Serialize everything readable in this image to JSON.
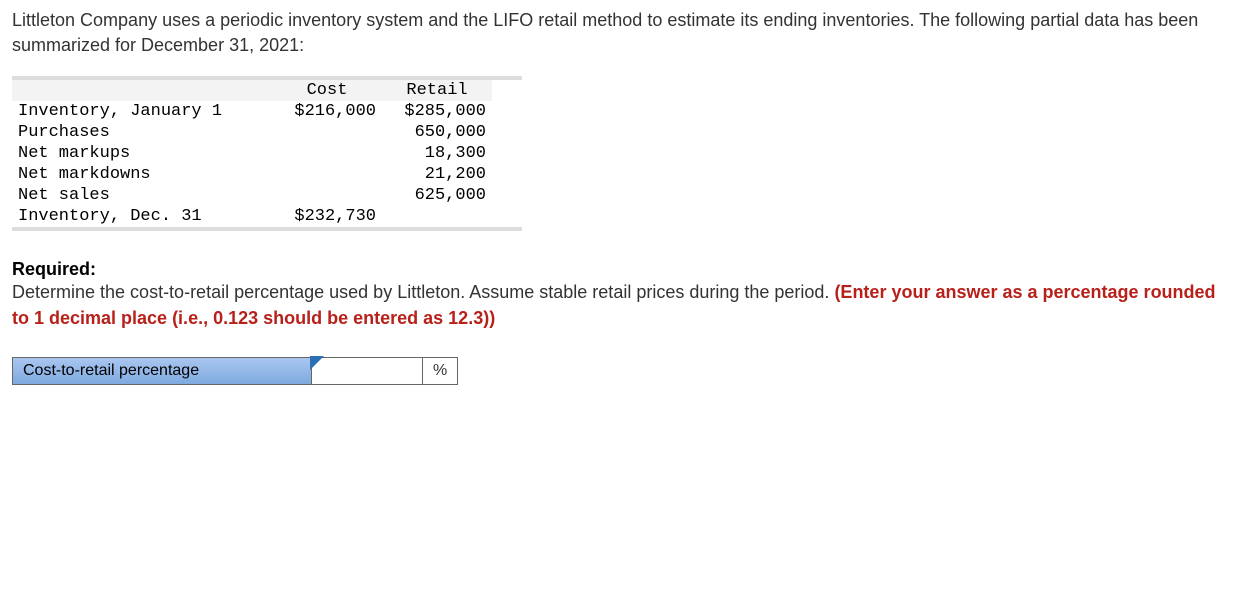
{
  "problem": {
    "text": "Littleton Company uses a periodic inventory system and the LIFO retail method to estimate its ending inventories. The following partial data has been summarized for December 31, 2021:"
  },
  "table": {
    "headers": {
      "cost": "Cost",
      "retail": "Retail"
    },
    "rows": [
      {
        "label": "Inventory, January 1",
        "cost": "$216,000",
        "retail": "$285,000"
      },
      {
        "label": "Purchases",
        "cost": "",
        "retail": "650,000"
      },
      {
        "label": "Net markups",
        "cost": "",
        "retail": "18,300"
      },
      {
        "label": "Net markdowns",
        "cost": "",
        "retail": "21,200"
      },
      {
        "label": "Net sales",
        "cost": "",
        "retail": "625,000"
      },
      {
        "label": "Inventory, Dec. 31",
        "cost": "$232,730",
        "retail": ""
      }
    ]
  },
  "required": {
    "heading": "Required:",
    "body": "Determine the cost-to-retail percentage used by Littleton. Assume stable retail prices during the period. ",
    "hint": "(Enter your answer as a percentage rounded to 1 decimal place (i.e., 0.123 should be entered as 12.3))"
  },
  "answer": {
    "label": "Cost-to-retail percentage",
    "value": "",
    "unit": "%"
  }
}
